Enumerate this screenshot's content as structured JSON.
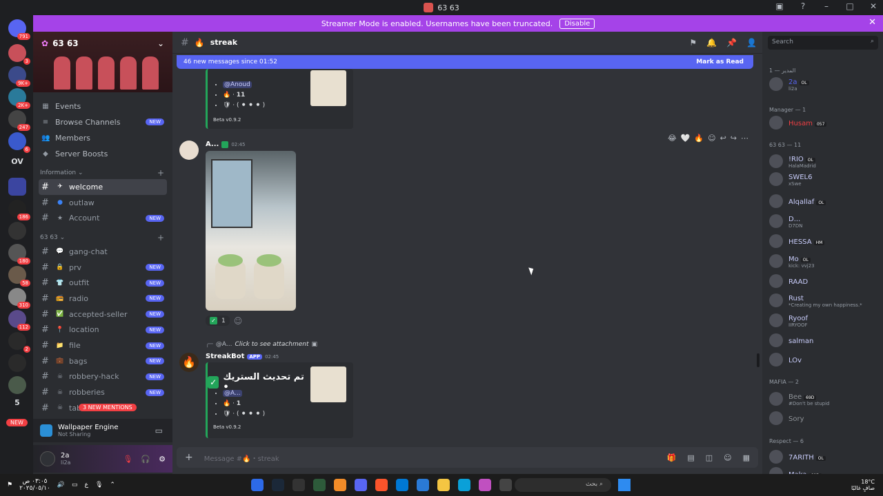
{
  "window": {
    "title": "63 63"
  },
  "banner": {
    "text": "Streamer Mode is enabled. Usernames have been truncated.",
    "disable": "Disable"
  },
  "guilds": {
    "badges": [
      "791",
      "3",
      "9K+",
      "2K+",
      "247",
      "6",
      "186",
      "180",
      "58",
      "310",
      "112",
      "2",
      "5"
    ],
    "ov": "OV",
    "new": "NEW"
  },
  "server": {
    "name": "63 63",
    "nav": [
      "Events",
      "Browse Channels",
      "Members",
      "Server Boosts"
    ],
    "nav_new": "NEW",
    "categories": [
      "Information",
      "63 63"
    ],
    "info_channels": [
      {
        "name": "welcome",
        "emoji": "✈"
      },
      {
        "name": "outlaw",
        "emoji": "●"
      },
      {
        "name": "Account",
        "emoji": "★",
        "new": "NEW"
      }
    ],
    "channels": [
      {
        "name": "gang-chat",
        "emoji": "💬"
      },
      {
        "name": "prv",
        "emoji": "🔒",
        "new": "NEW"
      },
      {
        "name": "outfit",
        "emoji": "👕",
        "new": "NEW"
      },
      {
        "name": "radio",
        "emoji": "📻",
        "new": "NEW"
      },
      {
        "name": "accepted-seller",
        "emoji": "✅",
        "new": "NEW"
      },
      {
        "name": "location",
        "emoji": "📍",
        "new": "NEW"
      },
      {
        "name": "file",
        "emoji": "📁",
        "new": "NEW"
      },
      {
        "name": "bags",
        "emoji": "💼",
        "new": "NEW"
      },
      {
        "name": "robbery-hack",
        "emoji": "☠",
        "new": "NEW"
      },
      {
        "name": "robberies",
        "emoji": "☠",
        "new": "NEW"
      },
      {
        "name": "table",
        "emoji": "☠"
      }
    ],
    "mentions": "3 NEW MENTIONS"
  },
  "activity": {
    "title": "Wallpaper Engine",
    "sub": "Not Sharing"
  },
  "user": {
    "name": "2a",
    "status": "li2a"
  },
  "channel": {
    "name": "streak",
    "emoji": "🔥"
  },
  "newbar": {
    "text": "46 new messages since 01:52",
    "mark": "Mark as Read"
  },
  "embed1": {
    "mention": "@Anoud",
    "count": "11",
    "footer": "Beta v0.9.2"
  },
  "message": {
    "author": "A...",
    "time": "02:45",
    "reaction_count": "1"
  },
  "reply": {
    "author": "@A...",
    "text": "Click to see attachment"
  },
  "bot": {
    "author": "StreakBot",
    "app": "APP",
    "time": "02:45",
    "title": "تم تحديث الستريك •",
    "mention": "@A...",
    "count": "1",
    "footer": "Beta v0.9.2"
  },
  "composer": {
    "placeholder": "Message #🔥・streak"
  },
  "members_panel": {
    "search": "Search",
    "cats": [
      "المدير — 1",
      "Manager — 1",
      "63 63 — 11",
      "MAFIA — 2",
      "Respect — 6"
    ],
    "list": [
      {
        "name": "2a",
        "tag": "OL",
        "status": "li2a",
        "color": "#5865f2"
      },
      {
        "name": "Husam",
        "tag": "057",
        "status": "",
        "color": "#f23f43"
      },
      {
        "name": "!RIO",
        "tag": "OL",
        "status": "HalaMadrid",
        "color": "#c9cdfb"
      },
      {
        "name": "SWEL6",
        "tag": "",
        "status": "xSwe",
        "color": "#c9cdfb"
      },
      {
        "name": "Alqallaf",
        "tag": "OL",
        "status": "",
        "color": "#c9cdfb"
      },
      {
        "name": "D...",
        "tag": "",
        "status": "D7DN",
        "color": "#c9cdfb"
      },
      {
        "name": "HESSA",
        "tag": "HM",
        "status": "",
        "color": "#c9cdfb"
      },
      {
        "name": "Mo",
        "tag": "OL",
        "status": "kick: vvj23",
        "color": "#c9cdfb"
      },
      {
        "name": "RAAD",
        "tag": "",
        "status": "",
        "color": "#c9cdfb"
      },
      {
        "name": "Rust",
        "tag": "",
        "status": "*Creating my own happiness.*",
        "color": "#c9cdfb"
      },
      {
        "name": "Ryoof",
        "tag": "",
        "status": "IIRYOOF",
        "color": "#c9cdfb"
      },
      {
        "name": "salman",
        "tag": "",
        "status": "",
        "color": "#c9cdfb"
      },
      {
        "name": "LOv",
        "tag": "",
        "status": "",
        "color": "#c9cdfb"
      },
      {
        "name": "Bee",
        "tag": "69D",
        "status": "#Don't be stupid",
        "color": "#8e9297"
      },
      {
        "name": "Sory",
        "tag": "",
        "status": "",
        "color": "#8e9297"
      },
      {
        "name": "7ARITH",
        "tag": "OL",
        "status": "",
        "color": "#c9cdfb"
      },
      {
        "name": "Maka",
        "tag": "69D",
        "status": "",
        "color": "#c9cdfb"
      }
    ]
  },
  "taskbar": {
    "time": "٠٣:٠٥ ص",
    "date": "٢٠٢٥/٠٥/١٠",
    "search": "بحث",
    "weather": "18°C",
    "weather_desc": "صافٍ غالبًا"
  },
  "colors": {
    "accent": "#5865f2",
    "streamer": "#a543e8",
    "online": "#23a55a"
  }
}
